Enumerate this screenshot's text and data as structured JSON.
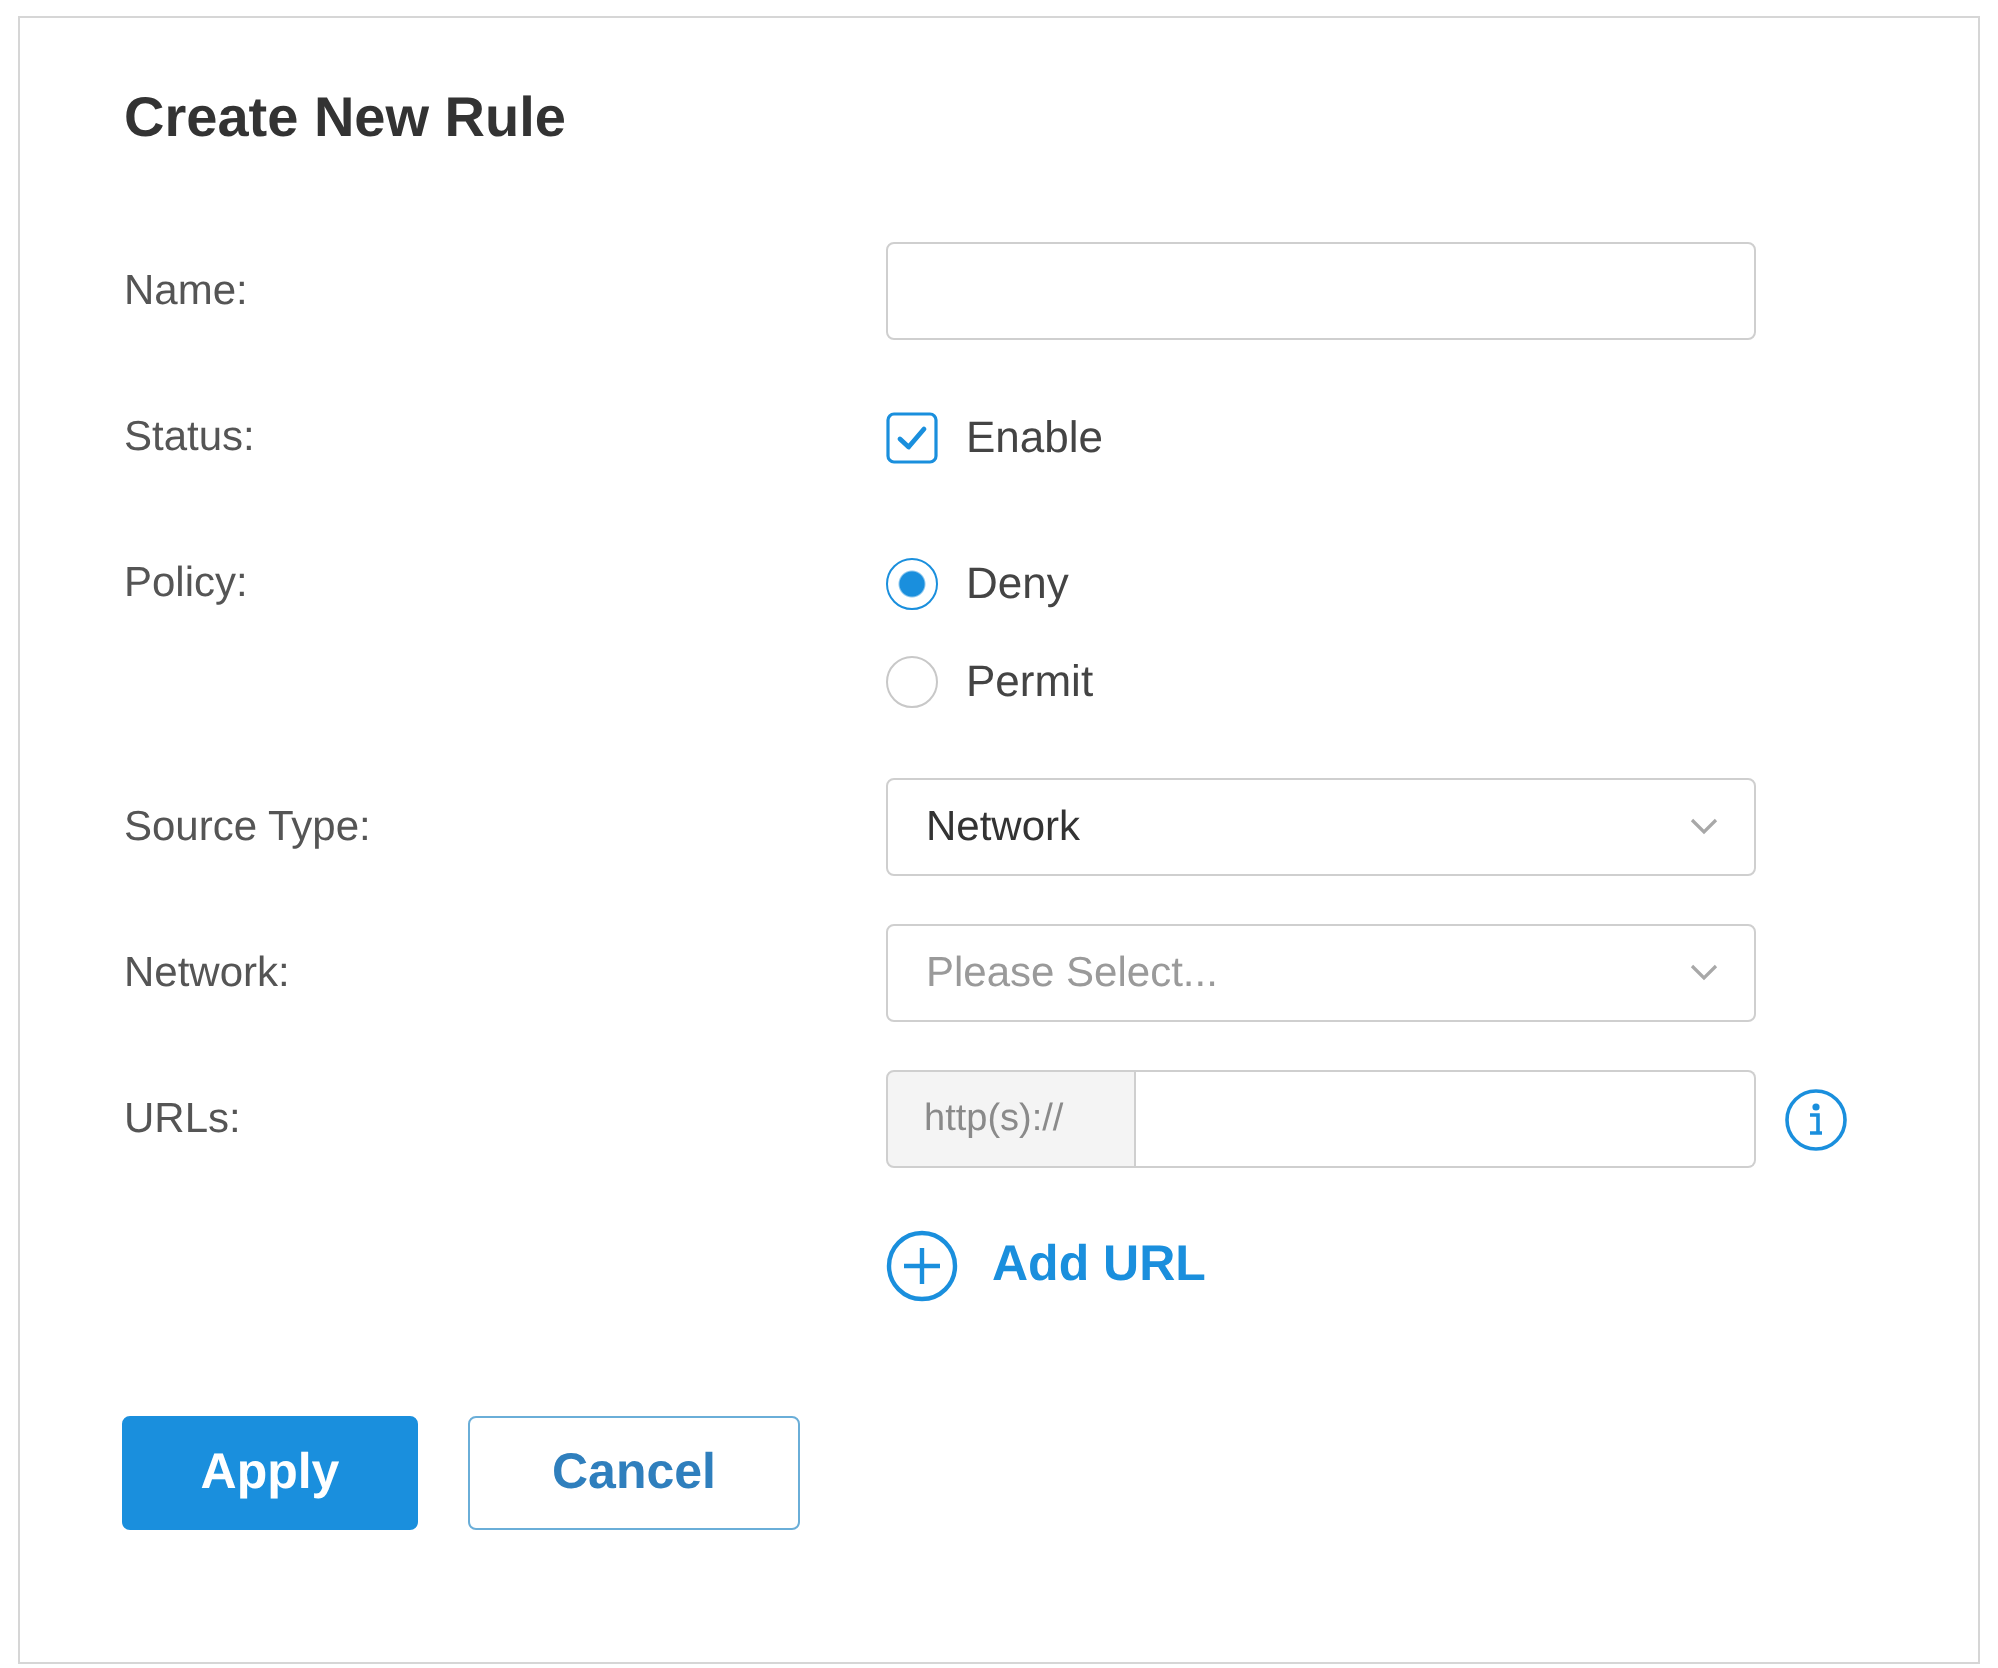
{
  "dialog": {
    "title": "Create New Rule"
  },
  "fields": [
    {
      "kind": "text",
      "label": "Name:"
    },
    {
      "kind": "checkbox",
      "label": "Status:",
      "option": "Enable",
      "checked": true
    },
    {
      "kind": "radio",
      "label": "Policy:",
      "options": [
        {
          "label": "Deny",
          "selected": true
        },
        {
          "label": "Permit",
          "selected": false
        }
      ]
    },
    {
      "kind": "select",
      "label": "Source Type:",
      "value": "Network"
    },
    {
      "kind": "select",
      "label": "Network:",
      "placeholder": "Please Select..."
    },
    {
      "kind": "url",
      "label": "URLs:",
      "prefix": "http(s)://"
    }
  ],
  "add_link": {
    "label": "Add URL"
  },
  "buttons": [
    {
      "label": "Apply",
      "kind": "primary"
    },
    {
      "label": "Cancel",
      "kind": "secondary"
    }
  ]
}
